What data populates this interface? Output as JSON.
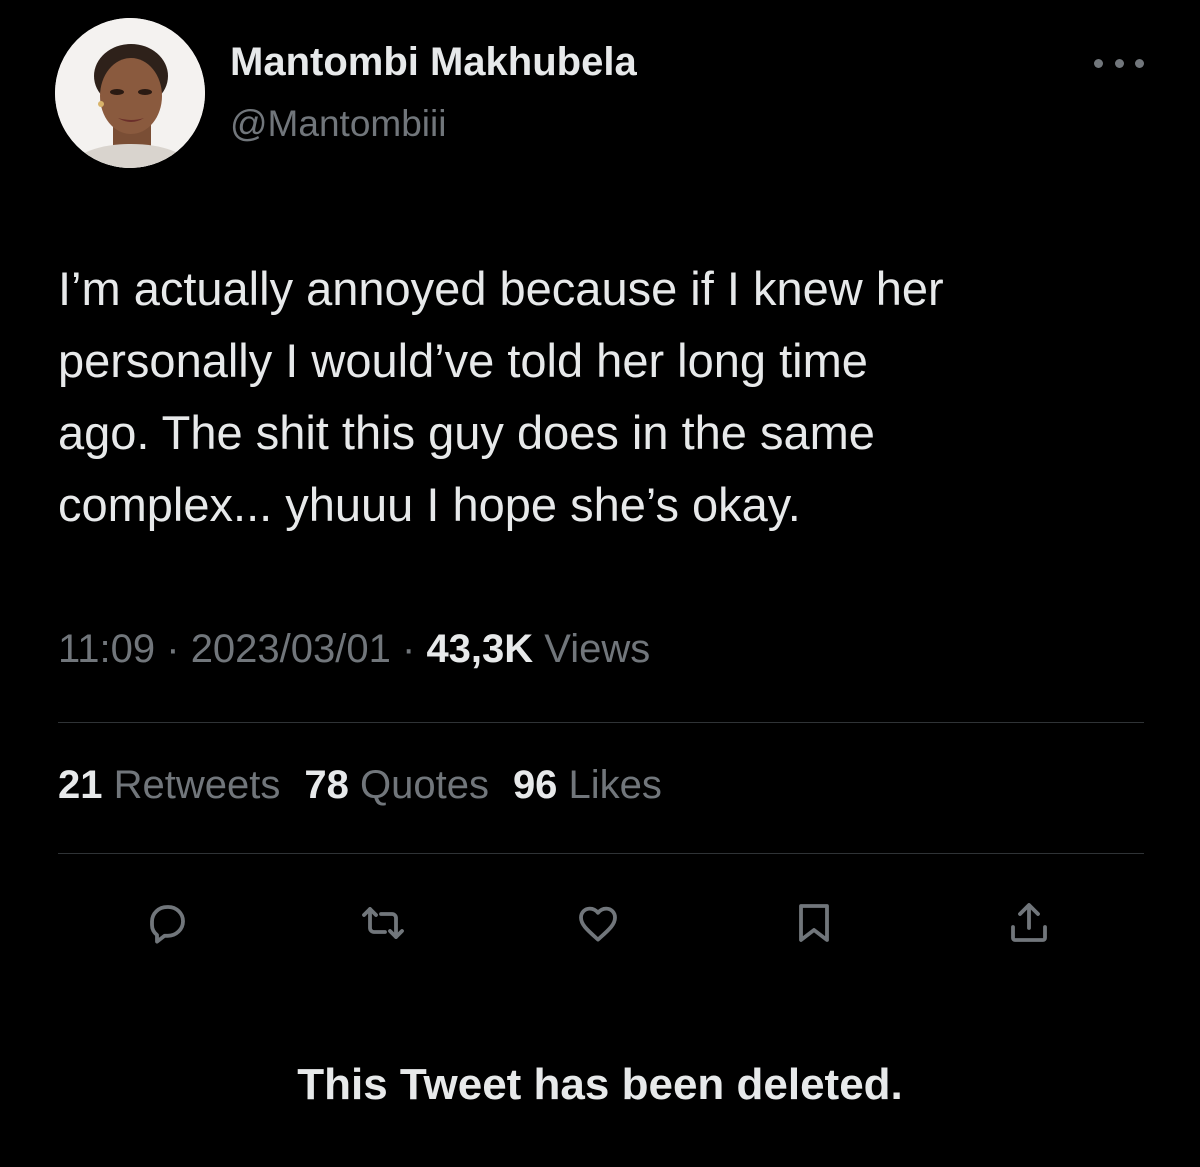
{
  "author": {
    "display_name": "Mantombi Makhubela",
    "handle": "@Mantombiii",
    "avatar_icon": "profile-photo"
  },
  "menu": {
    "icon": "more-horizontal-icon"
  },
  "tweet": {
    "lines": [
      "I’m actually annoyed because if I knew her",
      "personally I would’ve told her long time",
      "ago. The shit this guy does in the same",
      "complex... yhuuu I hope she’s okay."
    ]
  },
  "meta": {
    "time": "11:09",
    "separator": " · ",
    "date": "2023/03/01",
    "views_count": "43,3K",
    "views_label": " Views"
  },
  "stats": {
    "retweets_count": "21",
    "retweets_label": " Retweets",
    "quotes_count": "78",
    "quotes_label": " Quotes",
    "likes_count": "96",
    "likes_label": " Likes"
  },
  "actions": [
    {
      "name": "reply",
      "icon": "reply-icon"
    },
    {
      "name": "retweet",
      "icon": "retweet-icon"
    },
    {
      "name": "like",
      "icon": "heart-icon"
    },
    {
      "name": "bookmark",
      "icon": "bookmark-icon"
    },
    {
      "name": "share",
      "icon": "share-icon"
    }
  ],
  "notice": {
    "text": "This Tweet has been deleted."
  },
  "colors": {
    "background": "#000000",
    "primary_text": "#e7e9ea",
    "secondary_text": "#71767b",
    "divider": "#2f3336"
  }
}
